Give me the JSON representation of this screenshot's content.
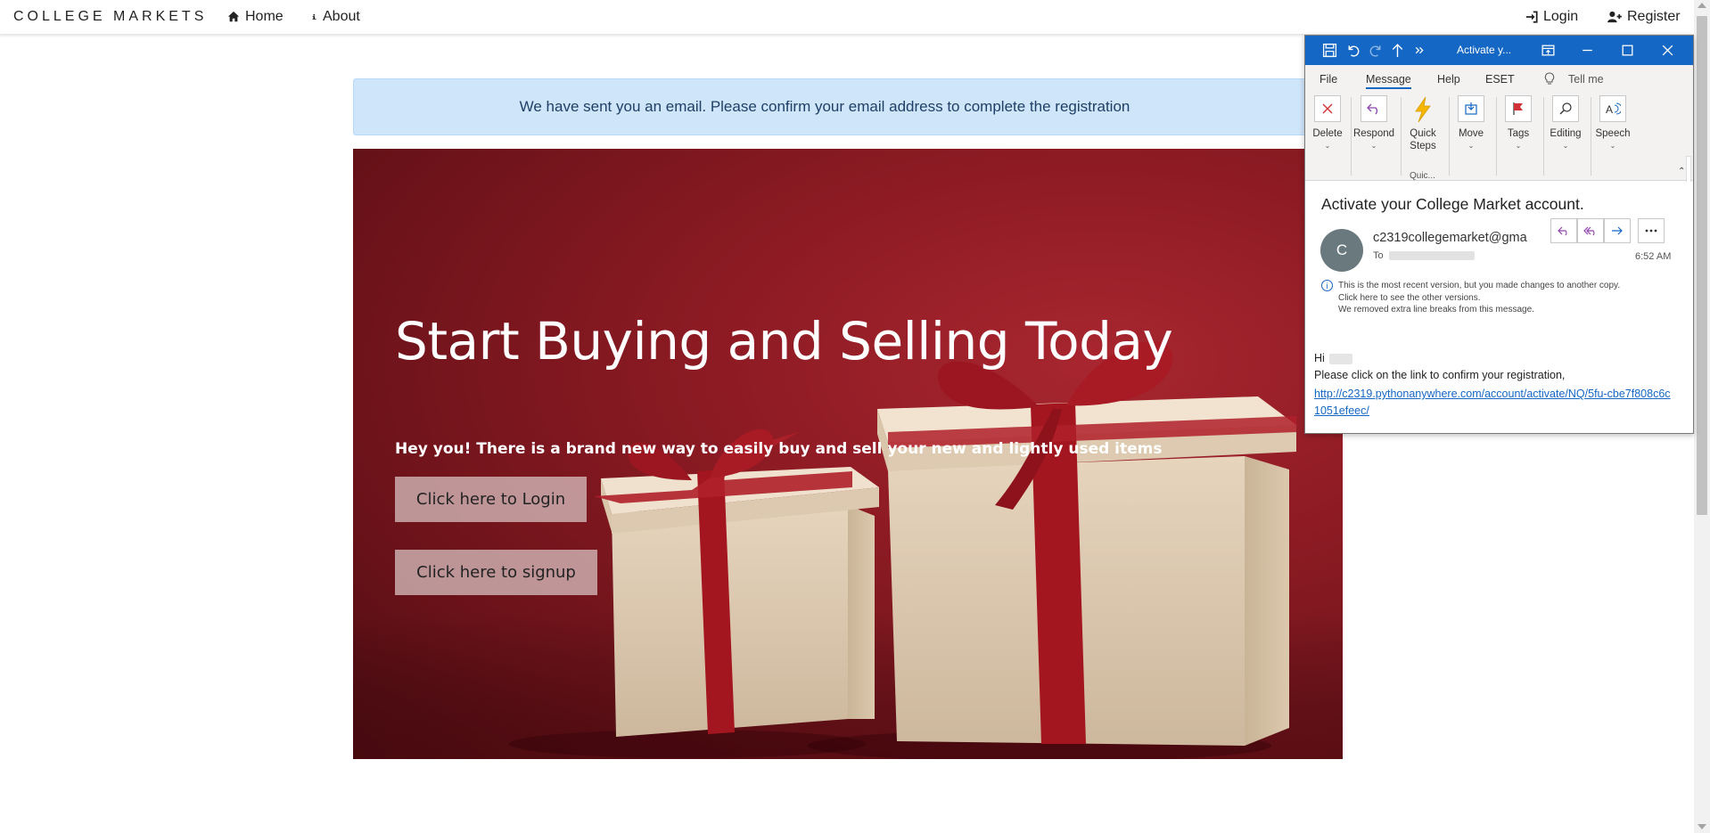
{
  "nav": {
    "brand": "COLLEGE MARKETS",
    "home": "Home",
    "about": "About",
    "login": "Login",
    "register": "Register"
  },
  "alert": {
    "message": "We have sent you an email. Please confirm your email address to complete the registration"
  },
  "hero": {
    "title": "Start Buying and Selling Today",
    "subtitle": "Hey you! There is a brand new way to easily buy and sell your new and lightly used items",
    "login_button": "Click here to Login",
    "signup_button": "Click here to signup"
  },
  "outlook": {
    "window_title": "Activate y...",
    "tabs": [
      "File",
      "Message",
      "Help",
      "ESET",
      "Tell me"
    ],
    "active_tab": "Message",
    "ribbon": {
      "delete": "Delete",
      "respond": "Respond",
      "quick_steps": "Quick Steps",
      "quick_group": "Quic...",
      "move": "Move",
      "tags": "Tags",
      "editing": "Editing",
      "speech": "Speech"
    },
    "message": {
      "subject": "Activate your College Market account.",
      "avatar_initial": "C",
      "sender": "c2319collegemarket@gma",
      "to_label": "To",
      "time": "6:52 AM",
      "info_line1": "This is the most recent version, but you made changes to another copy.",
      "info_line2": "Click here to see the other versions.",
      "info_line3": "We removed extra line breaks from this message.",
      "greeting": "Hi",
      "body": "Please click on the link to confirm your registration,",
      "link": "http://c2319.pythonanywhere.com/account/activate/NQ/5fu-cbe7f808c6c1051efeec/"
    }
  },
  "colors": {
    "outlook_blue": "#1467c4",
    "alert_bg": "#cfe5fa",
    "hero_red": "#8e1b24"
  }
}
